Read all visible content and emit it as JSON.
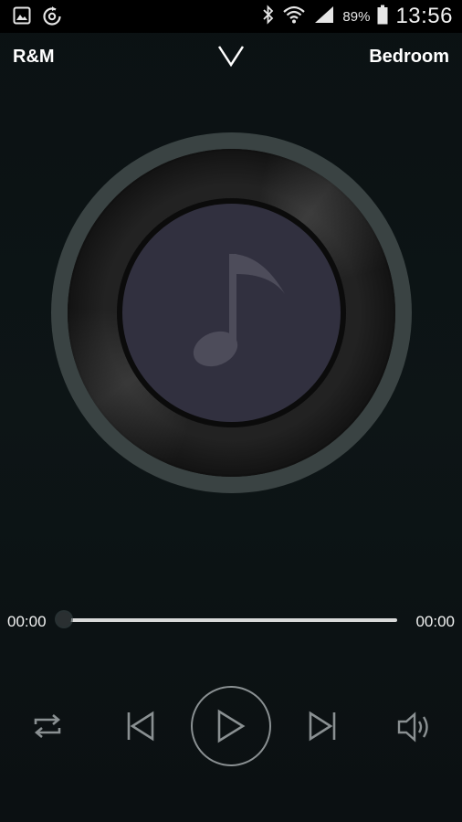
{
  "status_bar": {
    "battery_percent": "89%",
    "time": "13:56",
    "icons": [
      "gallery-icon",
      "sync-icon",
      "bluetooth-icon",
      "wifi-icon",
      "signal-icon",
      "battery-icon"
    ]
  },
  "header": {
    "left_label": "R&M",
    "right_label": "Bedroom",
    "collapse_icon": "chevron-down-icon"
  },
  "album_art": {
    "placeholder_icon": "music-note-icon"
  },
  "progress": {
    "current_time": "00:00",
    "total_time": "00:00",
    "fraction": 0
  },
  "controls": {
    "repeat_icon": "repeat-icon",
    "previous_icon": "previous-icon",
    "play_icon": "play-icon",
    "next_icon": "next-icon",
    "volume_icon": "volume-icon"
  },
  "colors": {
    "background": "#0c1314",
    "disc_outer": "#3a4343",
    "disc_label": "#31303f",
    "note": "#4d4c5a",
    "control_stroke": "#8a9092"
  }
}
